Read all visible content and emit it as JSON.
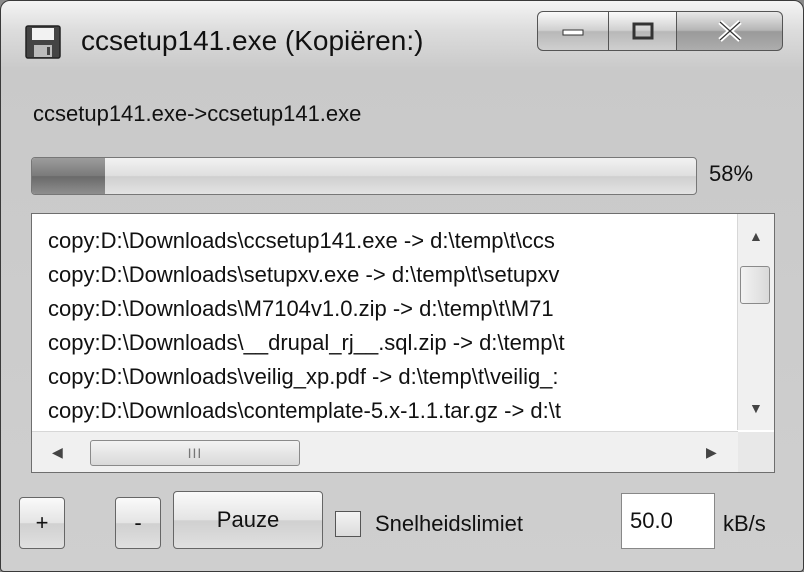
{
  "window": {
    "title": "ccsetup141.exe (Kopiëren:)",
    "icon": "save-icon",
    "controls": {
      "minimize": "minimize-icon",
      "maximize": "maximize-icon",
      "close": "close-icon"
    }
  },
  "copy": {
    "path": "ccsetup141.exe->ccsetup141.exe",
    "progress_percent_text": "58%",
    "progress_fill_fraction": 0.11
  },
  "log": {
    "items": [
      "copy:D:\\Downloads\\ccsetup141.exe -> d:\\temp\\t\\ccs",
      "copy:D:\\Downloads\\setupxv.exe -> d:\\temp\\t\\setupxv",
      "copy:D:\\Downloads\\M7104v1.0.zip -> d:\\temp\\t\\M71",
      "copy:D:\\Downloads\\__drupal_rj__.sql.zip -> d:\\temp\\t",
      "copy:D:\\Downloads\\veilig_xp.pdf -> d:\\temp\\t\\veilig_:",
      "copy:D:\\Downloads\\contemplate-5.x-1.1.tar.gz -> d:\\t"
    ]
  },
  "controls": {
    "plus_label": "+",
    "minus_label": "-",
    "pause_label": "Pauze",
    "speed_limit_label": "Snelheidslimiet",
    "speed_limit_checked": false,
    "speed_value": "50.0",
    "speed_unit": "kB/s"
  },
  "colors": {
    "progress_fill": "#7a7a7a"
  }
}
